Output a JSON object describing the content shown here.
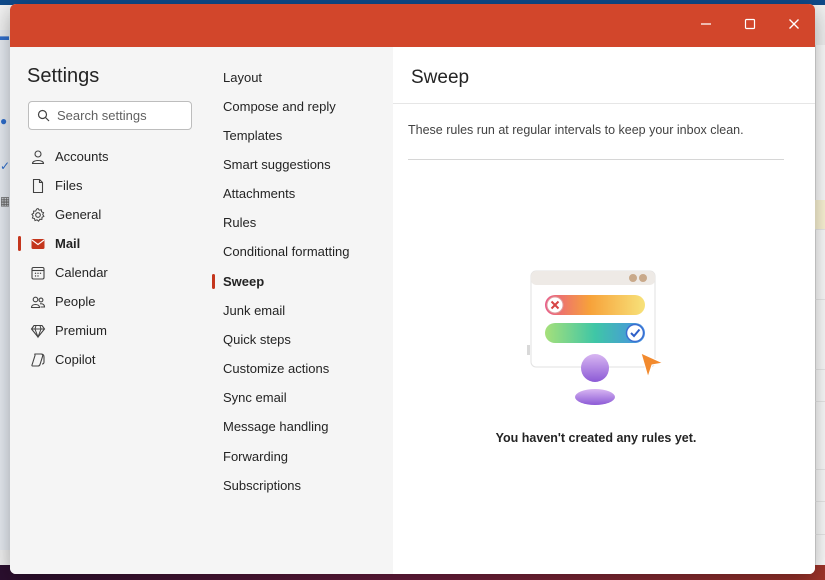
{
  "window": {
    "minimize_label": "",
    "maximize_label": "",
    "close_label": ""
  },
  "settings": {
    "title": "Settings",
    "search_placeholder": "Search settings",
    "nav": [
      {
        "label": "Accounts",
        "icon": "person-icon",
        "selected": false
      },
      {
        "label": "Files",
        "icon": "file-icon",
        "selected": false
      },
      {
        "label": "General",
        "icon": "gear-icon",
        "selected": false
      },
      {
        "label": "Mail",
        "icon": "mail-icon",
        "selected": true
      },
      {
        "label": "Calendar",
        "icon": "calendar-icon",
        "selected": false
      },
      {
        "label": "People",
        "icon": "people-icon",
        "selected": false
      },
      {
        "label": "Premium",
        "icon": "diamond-icon",
        "selected": false
      },
      {
        "label": "Copilot",
        "icon": "copilot-icon",
        "selected": false
      }
    ]
  },
  "mail_settings": {
    "items": [
      {
        "label": "Layout",
        "selected": false
      },
      {
        "label": "Compose and reply",
        "selected": false
      },
      {
        "label": "Templates",
        "selected": false
      },
      {
        "label": "Smart suggestions",
        "selected": false
      },
      {
        "label": "Attachments",
        "selected": false
      },
      {
        "label": "Rules",
        "selected": false
      },
      {
        "label": "Conditional formatting",
        "selected": false
      },
      {
        "label": "Sweep",
        "selected": true
      },
      {
        "label": "Junk email",
        "selected": false
      },
      {
        "label": "Quick steps",
        "selected": false
      },
      {
        "label": "Customize actions",
        "selected": false
      },
      {
        "label": "Sync email",
        "selected": false
      },
      {
        "label": "Message handling",
        "selected": false
      },
      {
        "label": "Forwarding",
        "selected": false
      },
      {
        "label": "Subscriptions",
        "selected": false
      }
    ]
  },
  "content": {
    "title": "Sweep",
    "description": "These rules run at regular intervals to keep your inbox clean.",
    "empty_message": "You haven't created any rules yet."
  },
  "colors": {
    "titlebar": "#d2462b",
    "accent": "#c4361d",
    "nav_background": "#f5f5f5"
  }
}
